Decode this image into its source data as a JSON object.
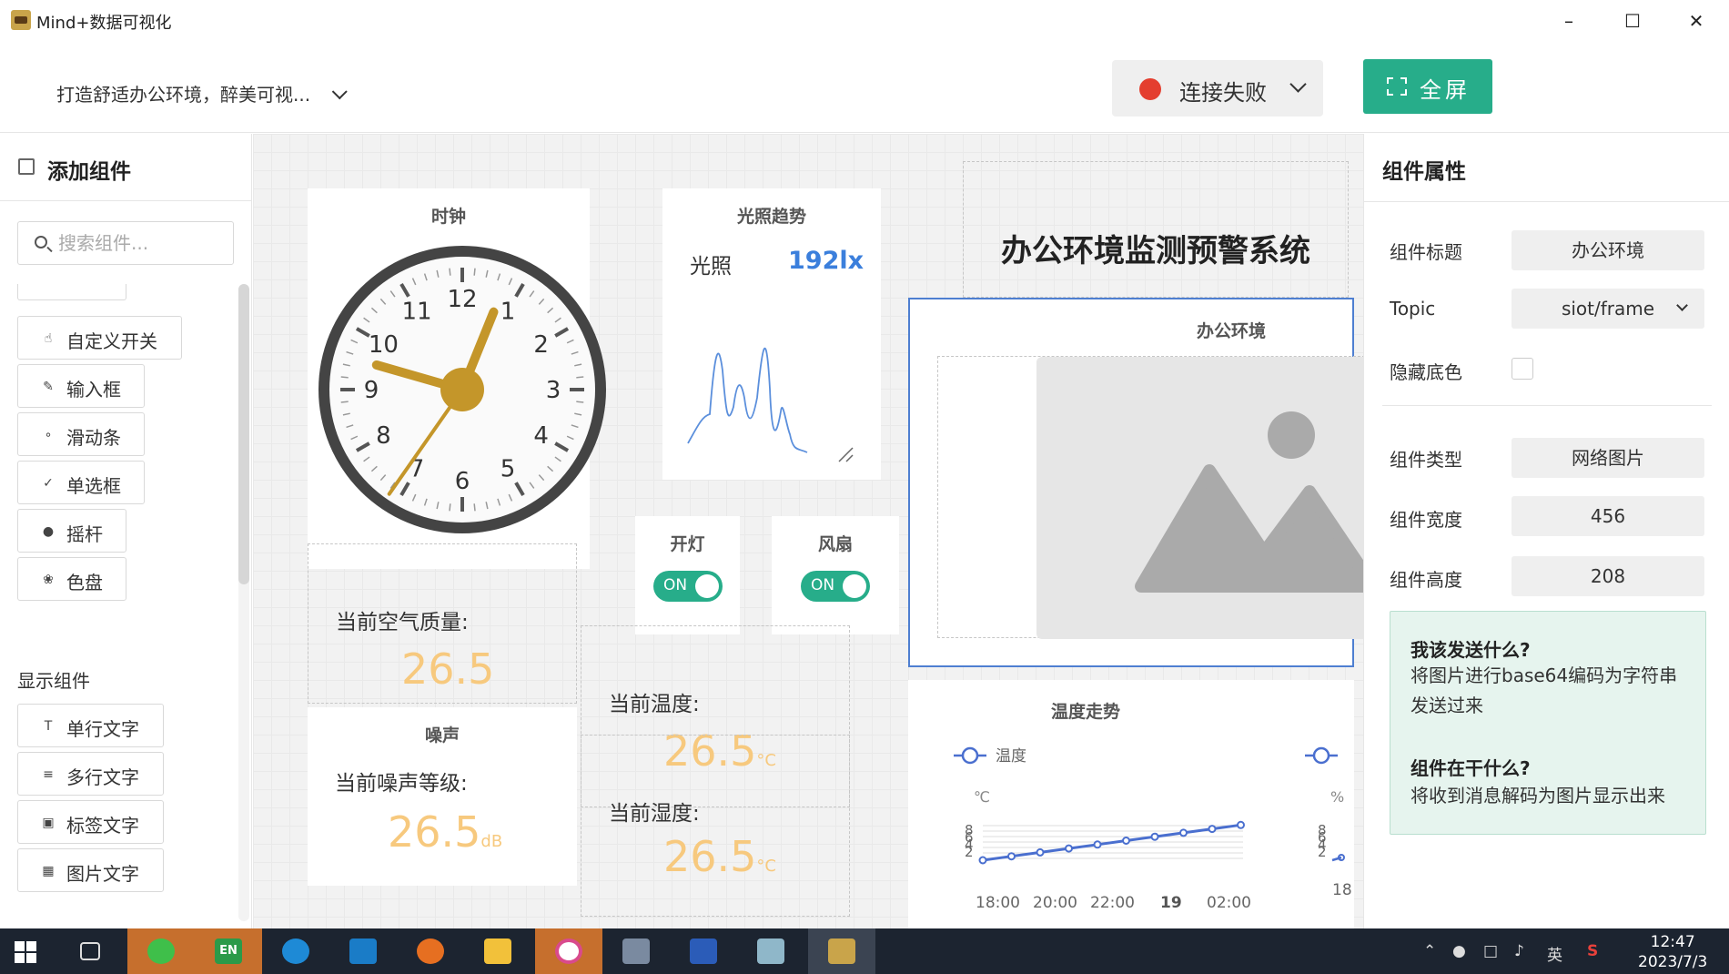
{
  "window": {
    "title": "Mind+数据可视化",
    "controls": [
      "minimize",
      "maximize",
      "close"
    ]
  },
  "toolbar": {
    "project_name": "打造舒适办公环境，醉美可视...",
    "connection_status": "连接失败",
    "connection_status_color": "#e43e2f",
    "fullscreen_label": "全屏",
    "accent_color": "#27ad8a"
  },
  "left_panel": {
    "title": "添加组件",
    "search_placeholder": "搜索组件...",
    "input_components": [
      {
        "label": "自定义开关",
        "icon": "hand-icon"
      },
      {
        "label": "输入框",
        "icon": "edit-box-icon"
      },
      {
        "label": "滑动条",
        "icon": "slider-icon"
      },
      {
        "label": "单选框",
        "icon": "check-circle-icon"
      },
      {
        "label": "摇杆",
        "icon": "joystick-icon"
      },
      {
        "label": "色盘",
        "icon": "palette-icon"
      }
    ],
    "display_section_label": "显示组件",
    "display_components": [
      {
        "label": "单行文字",
        "icon": "text-line-icon"
      },
      {
        "label": "多行文字",
        "icon": "text-multi-icon"
      },
      {
        "label": "标签文字",
        "icon": "tag-text-icon"
      },
      {
        "label": "图片文字",
        "icon": "image-text-icon"
      }
    ]
  },
  "canvas": {
    "clock": {
      "title": "时钟",
      "numbers": [
        "12",
        "1",
        "2",
        "3",
        "4",
        "5",
        "6",
        "7",
        "8",
        "9",
        "10",
        "11"
      ]
    },
    "light": {
      "title": "光照趋势",
      "label": "光照",
      "value": "192lx"
    },
    "light_toggle": {
      "title": "开灯",
      "state": "ON"
    },
    "fan_toggle": {
      "title": "风扇",
      "state": "ON"
    },
    "header_text": "办公环境监测预警系统",
    "image_widget": {
      "title": "办公环境"
    },
    "air_quality": {
      "label": "当前空气质量:",
      "value": "26.5"
    },
    "noise": {
      "title": "噪声",
      "label": "当前噪声等级:",
      "value": "26.5",
      "unit": "dB"
    },
    "temperature": {
      "label": "当前温度:",
      "value": "26.5",
      "unit": "°C"
    },
    "humidity": {
      "label": "当前湿度:",
      "value": "26.5",
      "unit": "°C"
    },
    "temp_trend": {
      "title": "温度走势",
      "legend_temp": "温度",
      "unit_c": "℃",
      "unit_pct": "%",
      "y_ticks": [
        "8",
        "6",
        "4",
        "2"
      ],
      "x_ticks": [
        "18:00",
        "20:00",
        "22:00",
        "19",
        "02:00"
      ],
      "right_x_tick": "18"
    }
  },
  "right_panel": {
    "title": "组件属性",
    "props": [
      {
        "label": "组件标题",
        "value": "办公环境"
      },
      {
        "label": "Topic",
        "value": "siot/frame"
      },
      {
        "label": "隐藏底色",
        "value": ""
      },
      {
        "label": "组件类型",
        "value": "网络图片"
      },
      {
        "label": "组件宽度",
        "value": "456"
      },
      {
        "label": "组件高度",
        "value": "208"
      }
    ],
    "help": {
      "q1": "我该发送什么?",
      "a1": "将图片进行base64编码为字符串发送过来",
      "q2": "组件在干什么?",
      "a2": "将收到消息解码为图片显示出来"
    }
  },
  "taskbar": {
    "time": "12:47",
    "date": "2023/7/3",
    "ime": "英",
    "lang": "EN"
  }
}
